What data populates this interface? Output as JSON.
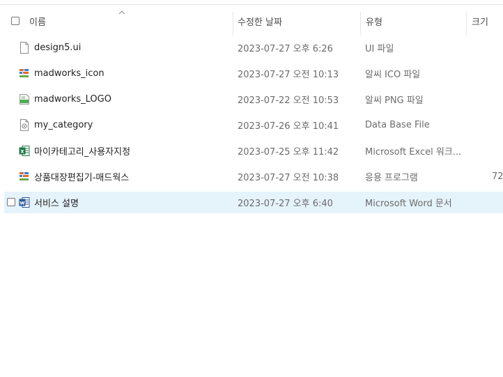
{
  "header": {
    "name": "이름",
    "date_modified": "수정한 날짜",
    "type": "유형",
    "size": "크기"
  },
  "files": [
    {
      "name": "design5.ui",
      "date": "2023-07-27 오후 6:26",
      "type": "UI 파일",
      "size": "",
      "icon": "document-icon"
    },
    {
      "name": "madworks_icon",
      "date": "2023-07-27 오전 10:13",
      "type": "알씨 ICO 파일",
      "size": "",
      "icon": "ico-file-icon"
    },
    {
      "name": "madworks_LOGO",
      "date": "2023-07-22 오전 10:53",
      "type": "알씨 PNG 파일",
      "size": "",
      "icon": "png-file-icon"
    },
    {
      "name": "my_category",
      "date": "2023-07-26 오후 10:41",
      "type": "Data Base File",
      "size": "",
      "icon": "database-file-icon"
    },
    {
      "name": "마이카테고리_사용자지정",
      "date": "2023-07-25 오후 11:42",
      "type": "Microsoft Excel 워크...",
      "size": "",
      "icon": "excel-file-icon"
    },
    {
      "name": "상품대장편집기-매드웍스",
      "date": "2023-07-27 오전 10:38",
      "type": "응용 프로그램",
      "size": "72",
      "icon": "application-icon"
    },
    {
      "name": "서비스 설명",
      "date": "2023-07-27 오후 6:40",
      "type": "Microsoft Word 문서",
      "size": "",
      "icon": "word-file-icon"
    }
  ]
}
